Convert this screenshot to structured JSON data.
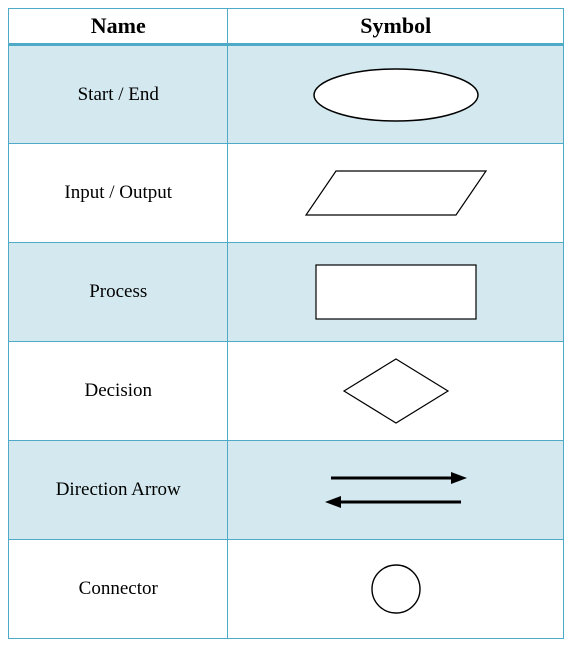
{
  "headers": {
    "name": "Name",
    "symbol": "Symbol"
  },
  "rows": [
    {
      "label": "Start / End",
      "icon": "terminator-icon",
      "shaded": true
    },
    {
      "label": "Input / Output",
      "icon": "io-parallelogram-icon",
      "shaded": false
    },
    {
      "label": "Process",
      "icon": "process-rect-icon",
      "shaded": true
    },
    {
      "label": "Decision",
      "icon": "decision-diamond-icon",
      "shaded": false
    },
    {
      "label": "Direction Arrow",
      "icon": "direction-arrows-icon",
      "shaded": true
    },
    {
      "label": "Connector",
      "icon": "connector-circle-icon",
      "shaded": false
    }
  ]
}
